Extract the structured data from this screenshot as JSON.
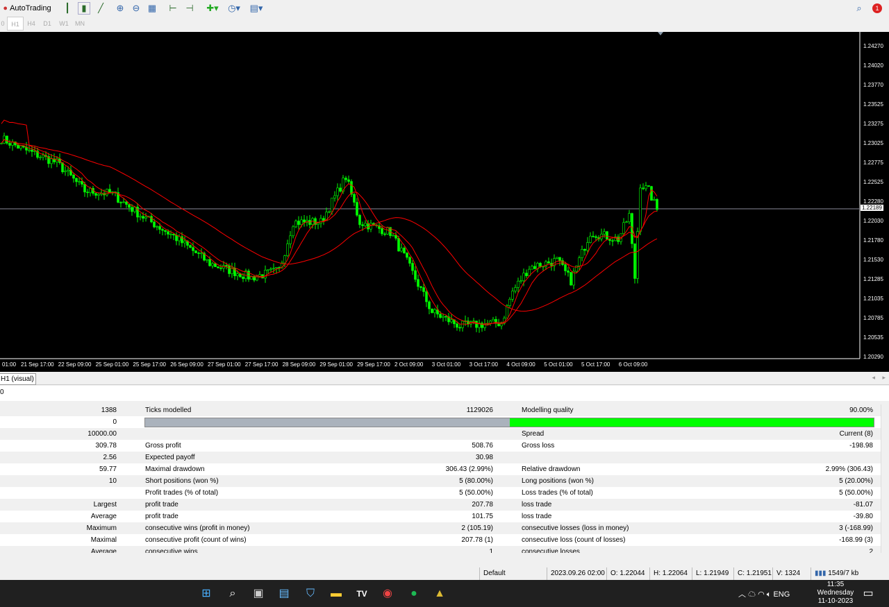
{
  "toolbar": {
    "autotrading_label": "AutoTrading",
    "icons": [
      "bar-chart-icon",
      "candlestick-icon",
      "line-chart-icon",
      "zoom-in-icon",
      "zoom-out-icon",
      "tile-windows-icon",
      "chart-shift-icon",
      "autoscroll-icon",
      "indicators-icon",
      "periods-icon",
      "templates-icon"
    ],
    "right_icons": [
      "search-icon",
      "notification-icon"
    ],
    "notification_count": "1"
  },
  "timeframes": [
    "0",
    "H1",
    "H4",
    "D1",
    "W1",
    "MN"
  ],
  "chart": {
    "background": "#000000",
    "candle_color": "#00ff00",
    "ma_color": "#ff0000",
    "y_ticks": [
      "1.24270",
      "1.24020",
      "1.23770",
      "1.23525",
      "1.23275",
      "1.23025",
      "1.22775",
      "1.22525",
      "1.22280",
      "1.22030",
      "1.21780",
      "1.21530",
      "1.21285",
      "1.21035",
      "1.20785",
      "1.20535",
      "1.20290"
    ],
    "current_price": "1.22189",
    "x_ticks": [
      "01:00",
      "21 Sep 17:00",
      "22 Sep 09:00",
      "25 Sep 01:00",
      "25 Sep 17:00",
      "26 Sep 09:00",
      "27 Sep 01:00",
      "27 Sep 17:00",
      "28 Sep 09:00",
      "29 Sep 01:00",
      "29 Sep 17:00",
      "2 Oct 09:00",
      "3 Oct 01:00",
      "3 Oct 17:00",
      "4 Oct 09:00",
      "5 Oct 01:00",
      "5 Oct 17:00",
      "6 Oct 09:00"
    ]
  },
  "chart_data": {
    "type": "candlestick",
    "ylim": [
      1.2029,
      1.2427
    ],
    "price_path": [
      [
        0,
        1.231
      ],
      [
        8,
        1.2296
      ],
      [
        20,
        1.2279
      ],
      [
        30,
        1.2243
      ],
      [
        40,
        1.2239
      ],
      [
        50,
        1.2212
      ],
      [
        62,
        1.2185
      ],
      [
        75,
        1.215
      ],
      [
        90,
        1.2132
      ],
      [
        100,
        1.2141
      ],
      [
        105,
        1.2203
      ],
      [
        115,
        1.2203
      ],
      [
        124,
        1.2261
      ],
      [
        129,
        1.2203
      ],
      [
        140,
        1.219
      ],
      [
        145,
        1.2159
      ],
      [
        155,
        1.2088
      ],
      [
        165,
        1.207
      ],
      [
        180,
        1.2074
      ],
      [
        184,
        1.2114
      ],
      [
        190,
        1.2145
      ],
      [
        200,
        1.2154
      ],
      [
        205,
        1.2128
      ],
      [
        212,
        1.219
      ],
      [
        222,
        1.2181
      ],
      [
        226,
        1.2212
      ],
      [
        228,
        1.2132
      ],
      [
        230,
        1.2252
      ],
      [
        233,
        1.2243
      ],
      [
        236,
        1.2219
      ]
    ]
  },
  "tab": {
    "label": "H1 (visual)"
  },
  "input_value": "0",
  "results": {
    "rows": [
      [
        "1388",
        "Ticks modelled",
        "1129026",
        "Modelling quality",
        "90.00%"
      ],
      [
        "0",
        "",
        "",
        "",
        ""
      ],
      [
        "10000.00",
        "",
        "",
        "Spread",
        "Current (8)"
      ],
      [
        "309.78",
        "Gross profit",
        "508.76",
        "Gross loss",
        "-198.98"
      ],
      [
        "2.56",
        "Expected payoff",
        "30.98",
        "",
        ""
      ],
      [
        "59.77",
        "Maximal drawdown",
        "306.43 (2.99%)",
        "Relative drawdown",
        "2.99% (306.43)"
      ],
      [
        "10",
        "Short positions (won %)",
        "5 (80.00%)",
        "Long positions (won %)",
        "5 (20.00%)"
      ],
      [
        "",
        "Profit trades (% of total)",
        "5 (50.00%)",
        "Loss trades (% of total)",
        "5 (50.00%)"
      ],
      [
        "Largest",
        "profit trade",
        "207.78",
        "loss trade",
        "-81.07"
      ],
      [
        "Average",
        "profit trade",
        "101.75",
        "loss trade",
        "-39.80"
      ],
      [
        "Maximum",
        "consecutive wins (profit in money)",
        "2 (105.19)",
        "consecutive losses (loss in money)",
        "3 (-168.99)"
      ],
      [
        "Maximal",
        "consecutive profit (count of wins)",
        "207.78 (1)",
        "consecutive loss (count of losses)",
        "-168.99 (3)"
      ],
      [
        "Average",
        "consecutive wins",
        "1",
        "consecutive losses",
        "2"
      ]
    ],
    "modelling_quality_fraction": 0.5
  },
  "status": {
    "profile": "Default",
    "datetime": "2023.09.26 02:00",
    "open": "O: 1.22044",
    "high": "H: 1.22064",
    "low": "L: 1.21949",
    "close": "C: 1.21951",
    "volume": "V: 1324",
    "traffic": "1549/7 kb"
  },
  "taskbar": {
    "apps": [
      "windows-start-icon",
      "search-icon",
      "task-view-icon",
      "widgets-icon",
      "store-icon",
      "file-explorer-icon",
      "tradingview-icon",
      "chrome-icon",
      "spotify-icon",
      "metatrader-icon"
    ],
    "language": "ENG",
    "time": "11:35",
    "day": "Wednesday",
    "date": "11-10-2023"
  }
}
